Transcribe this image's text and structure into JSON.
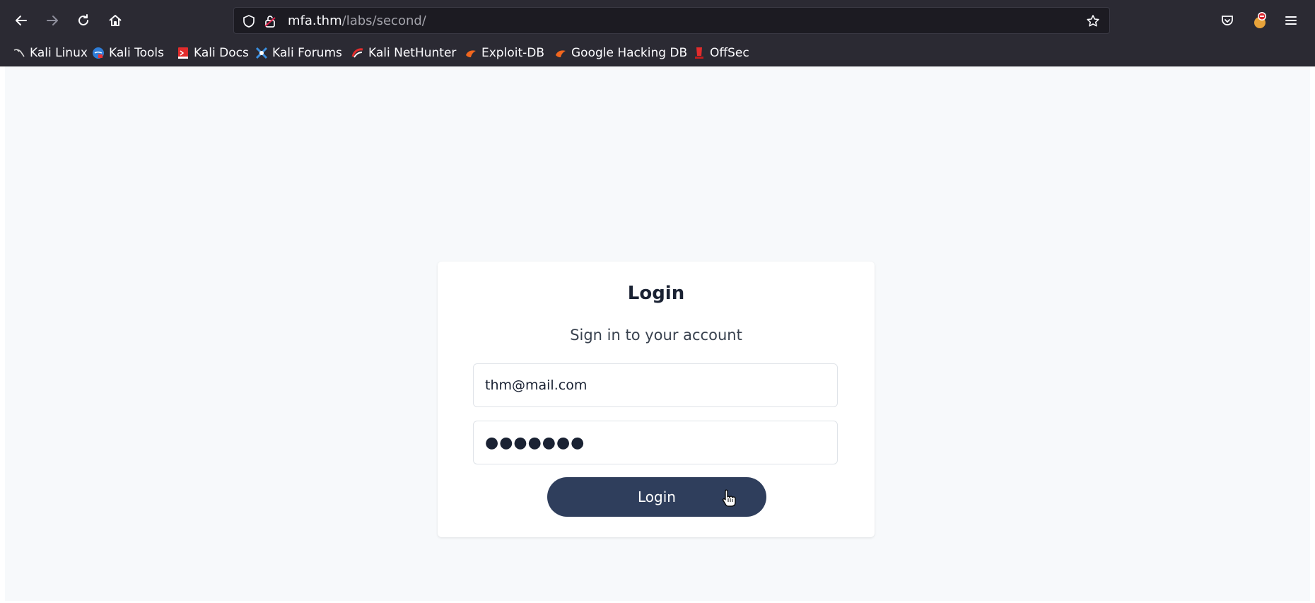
{
  "browser": {
    "url": {
      "host": "mfa.thm",
      "path": "/labs/second/"
    },
    "nav_icons": [
      "back-icon",
      "forward-icon",
      "reload-icon",
      "home-icon"
    ],
    "toolbar_icons": [
      "pocket-icon",
      "extension-icon",
      "menu-icon"
    ]
  },
  "bookmarks": [
    {
      "label": "Kali Linux",
      "icon": "kali-linux-icon"
    },
    {
      "label": "Kali Tools",
      "icon": "kali-tools-icon"
    },
    {
      "label": "Kali Docs",
      "icon": "kali-docs-icon"
    },
    {
      "label": "Kali Forums",
      "icon": "kali-forums-icon"
    },
    {
      "label": "Kali NetHunter",
      "icon": "kali-nethunter-icon"
    },
    {
      "label": "Exploit-DB",
      "icon": "exploit-db-icon"
    },
    {
      "label": "Google Hacking DB",
      "icon": "google-hacking-db-icon"
    },
    {
      "label": "OffSec",
      "icon": "offsec-icon"
    }
  ],
  "login": {
    "title": "Login",
    "subtitle": "Sign in to your account",
    "email_value": "thm@mail.com",
    "password_mask": "●●●●●●●",
    "button_label": "Login"
  },
  "colors": {
    "toolbar_bg": "#2b2a33",
    "page_bg": "#f7f9fb",
    "button_bg": "#2f3e5c",
    "title_color": "#1a2233"
  }
}
